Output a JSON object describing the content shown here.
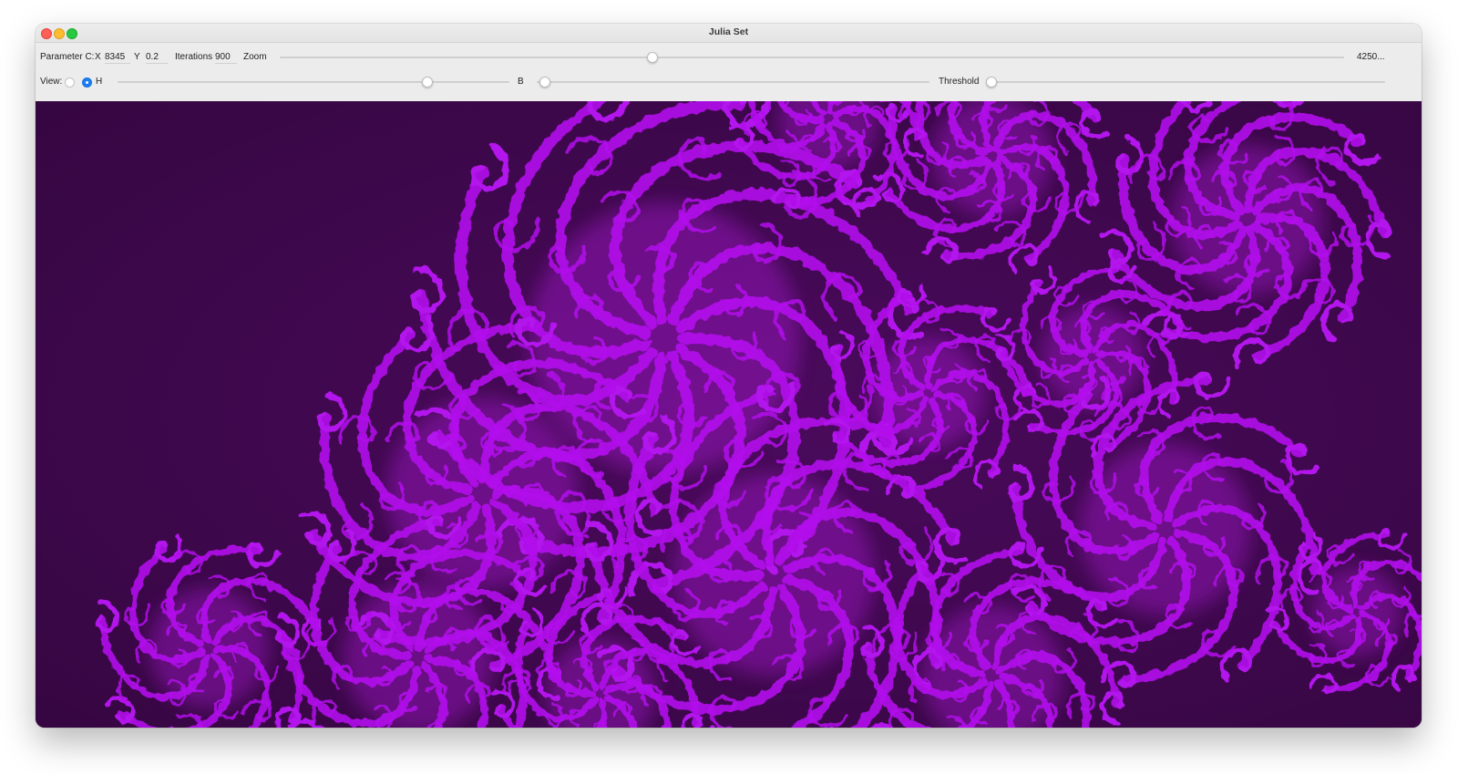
{
  "window": {
    "title": "Julia Set"
  },
  "toolbar": {
    "parameter_c_label": "Parameter C:",
    "x_label": "X",
    "x_value": "8345",
    "y_label": "Y",
    "y_value": "0.2",
    "iterations_label": "Iterations",
    "iterations_value": "900",
    "zoom_label": "Zoom",
    "zoom_slider_fraction": 0.35,
    "zoom_readout": "4250..."
  },
  "view_row": {
    "view_label": "View:",
    "radio_h_label": "H",
    "selected_view": "H",
    "h_slider_fraction": 0.79,
    "b_label": "B",
    "b_slider_fraction": 0.02,
    "threshold_label": "Threshold",
    "threshold_slider_fraction": 0.0
  },
  "canvas": {
    "background_color": "#390845",
    "fractal_color": "#b312ec",
    "fractal_glow_color": "#c01ef0"
  }
}
